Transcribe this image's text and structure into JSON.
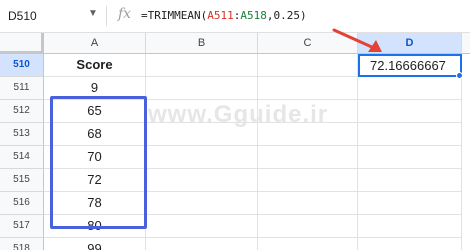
{
  "formula_bar": {
    "name_box": "D510",
    "fx_label": "fx",
    "formula_prefix": "=TRIMMEAN(",
    "formula_ref1": "A511",
    "formula_colon": ":",
    "formula_ref2": "A518",
    "formula_suffix": ",0.25)"
  },
  "columns": [
    "A",
    "B",
    "C",
    "D"
  ],
  "rows": [
    {
      "num": "510",
      "a": "Score",
      "d": "72.16666667"
    },
    {
      "num": "511",
      "a": "9"
    },
    {
      "num": "512",
      "a": "65"
    },
    {
      "num": "513",
      "a": "68"
    },
    {
      "num": "514",
      "a": "70"
    },
    {
      "num": "515",
      "a": "72"
    },
    {
      "num": "516",
      "a": "78"
    },
    {
      "num": "517",
      "a": "80"
    },
    {
      "num": "518",
      "a": "99"
    }
  ],
  "watermark": "www.Gguide.ir",
  "colors": {
    "selection": "#1a73e8",
    "highlight_box": "#4a61dd",
    "arrow": "#e34234"
  }
}
